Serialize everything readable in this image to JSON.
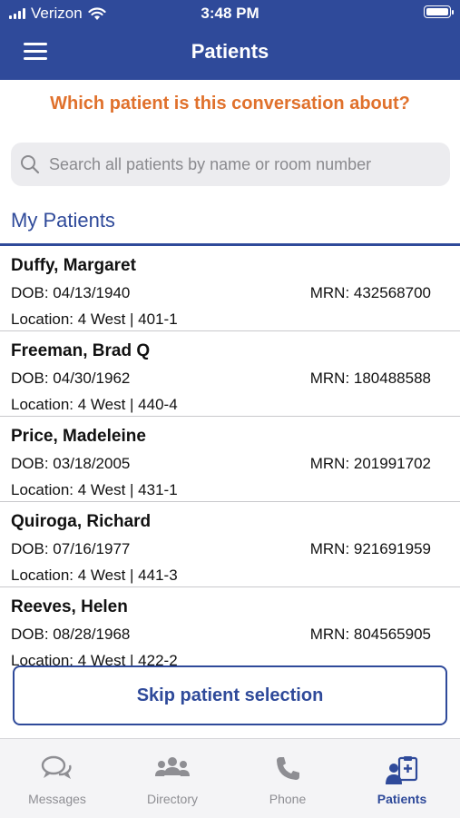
{
  "status_bar": {
    "carrier": "Verizon",
    "time": "3:48 PM"
  },
  "header": {
    "title": "Patients"
  },
  "prompt": "Which patient is this conversation about?",
  "search": {
    "placeholder": "Search all patients by name or room number",
    "value": ""
  },
  "section_title": "My Patients",
  "patients": [
    {
      "name": "Duffy, Margaret",
      "dob": "DOB: 04/13/1940",
      "mrn": "MRN: 432568700",
      "location": "Location: 4 West | 401-1"
    },
    {
      "name": "Freeman, Brad Q",
      "dob": "DOB: 04/30/1962",
      "mrn": "MRN: 180488588",
      "location": "Location: 4 West | 440-4"
    },
    {
      "name": "Price, Madeleine",
      "dob": "DOB: 03/18/2005",
      "mrn": "MRN: 201991702",
      "location": "Location: 4 West | 431-1"
    },
    {
      "name": "Quiroga, Richard",
      "dob": "DOB: 07/16/1977",
      "mrn": "MRN: 921691959",
      "location": "Location: 4 West | 441-3"
    },
    {
      "name": "Reeves, Helen",
      "dob": "DOB: 08/28/1968",
      "mrn": "MRN: 804565905",
      "location": "Location: 4 West | 422-2"
    }
  ],
  "skip_button": "Skip patient selection",
  "tabs": [
    {
      "label": "Messages",
      "icon": "chat-bubbles-icon"
    },
    {
      "label": "Directory",
      "icon": "group-icon"
    },
    {
      "label": "Phone",
      "icon": "phone-icon"
    },
    {
      "label": "Patients",
      "icon": "patient-chart-icon",
      "active": true
    }
  ],
  "colors": {
    "brand": "#2f4a9a",
    "accent": "#e0712c",
    "inactive": "#8e8e93"
  }
}
